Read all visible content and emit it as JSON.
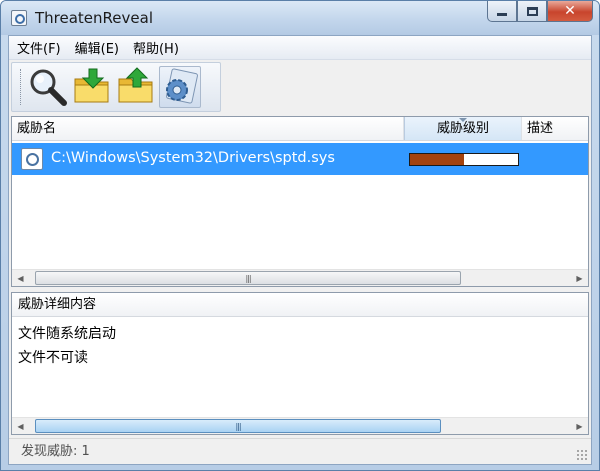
{
  "window": {
    "title": "ThreatenReveal"
  },
  "menu": {
    "items": [
      "文件(F)",
      "编辑(E)",
      "帮助(H)"
    ]
  },
  "toolbar": {
    "buttons": [
      {
        "icon": "magnifier-icon"
      },
      {
        "icon": "folder-download-icon"
      },
      {
        "icon": "folder-upload-icon"
      },
      {
        "icon": "settings-gear-icon"
      }
    ]
  },
  "threat_list": {
    "columns": [
      "威胁名",
      "威胁级别",
      "描述"
    ],
    "rows": [
      {
        "path": "C:\\Windows\\System32\\Drivers\\sptd.sys",
        "level_fraction": 0.5,
        "description": ""
      }
    ]
  },
  "details": {
    "header": "威胁详细内容",
    "lines": [
      "文件随系统启动",
      "文件不可读"
    ]
  },
  "status": {
    "text": "发现威胁: 1"
  },
  "colors": {
    "selection": "#3399ff",
    "level_fill": "#a3420e",
    "title_bar": "#c3d6ec",
    "close_button": "#c8452d"
  }
}
